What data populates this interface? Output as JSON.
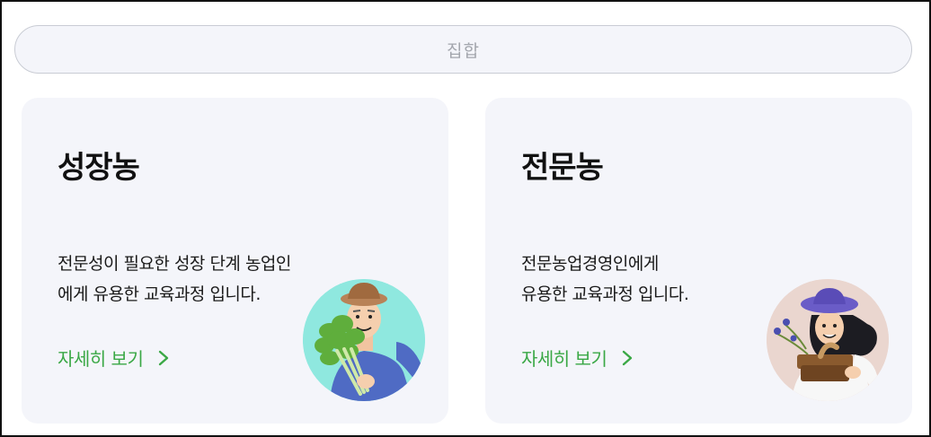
{
  "header": {
    "label": "집합"
  },
  "cards": [
    {
      "title": "성장농",
      "description_lines": [
        "전문성이 필요한 성장 단계 농업인",
        "에게 유용한 교육과정 입니다."
      ],
      "link_label": "자세히 보기",
      "illustration_icon": "farmer-with-celery-icon",
      "illustration_bg": "#8fe8df"
    },
    {
      "title": "전문농",
      "description_lines": [
        "전문농업경영인에게",
        "유용한 교육과정 입니다."
      ],
      "link_label": "자세히 보기",
      "illustration_icon": "farmer-woman-with-basket-icon",
      "illustration_bg": "#ead6cf"
    }
  ],
  "colors": {
    "link": "#3aa845",
    "card_bg": "#f4f5fa",
    "pill_text": "#a3a6ad"
  }
}
